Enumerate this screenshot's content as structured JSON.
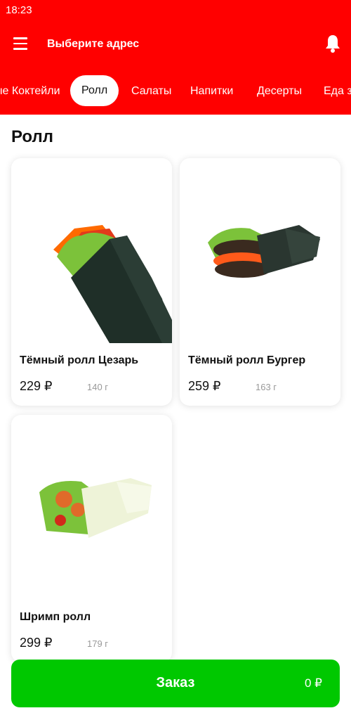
{
  "status_bar": {
    "time": "18:23"
  },
  "header": {
    "address_label": "Выберите адрес"
  },
  "tabs": [
    {
      "label": "ые Коктейли"
    },
    {
      "label": "Ролл"
    },
    {
      "label": "Салаты"
    },
    {
      "label": "Напитки"
    },
    {
      "label": "Десерты"
    },
    {
      "label": "Еда за"
    }
  ],
  "section": {
    "title": "Ролл"
  },
  "products": [
    {
      "name": "Тёмный ролл Цезарь",
      "price": "229 ₽",
      "weight": "140 г",
      "wrap_color": "dark-green"
    },
    {
      "name": "Тёмный ролл Бургер",
      "price": "259 ₽",
      "weight": "163 г",
      "wrap_color": "dark-green"
    },
    {
      "name": "Шримп ролл",
      "price": "299 ₽",
      "weight": "179 г",
      "wrap_color": "light"
    }
  ],
  "order": {
    "label": "Заказ",
    "total": "0 ₽"
  },
  "colors": {
    "header": "#ff0000",
    "order_button": "#00c800"
  }
}
